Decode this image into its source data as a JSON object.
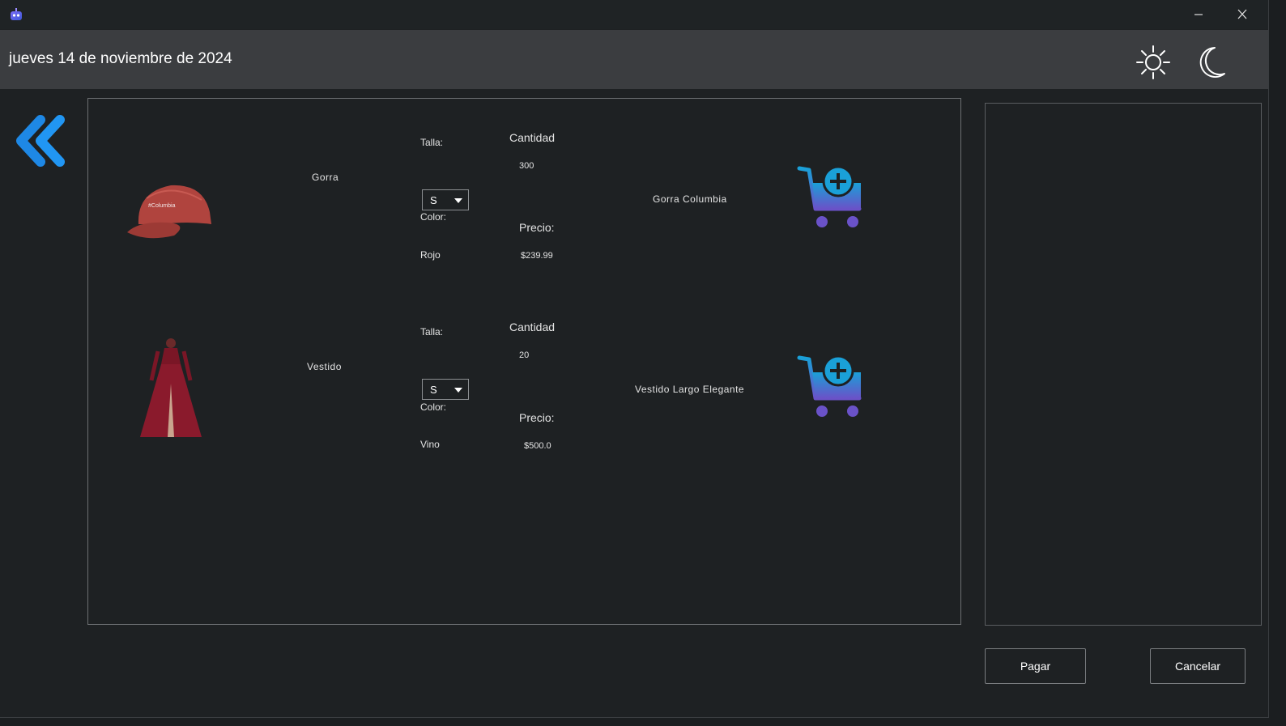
{
  "header": {
    "date": "jueves 14 de noviembre de 2024"
  },
  "icons": {
    "app": "app-icon",
    "minimize": "minimize-icon",
    "close": "close-icon",
    "light_theme": "sun-icon",
    "dark_theme": "moon-icon",
    "back": "double-chevron-left-icon",
    "add_to_cart": "cart-plus-icon"
  },
  "colors": {
    "accent": "#1e88e5",
    "background": "#1e2123",
    "header": "#3b3d40"
  },
  "products": [
    {
      "name": "Gorra",
      "image": "red-cap",
      "size_label": "Talla:",
      "size_value": "S",
      "color_label": "Color:",
      "color_value": "Rojo",
      "quantity_label": "Cantidad",
      "quantity_value": "300",
      "price_label": "Precio:",
      "price_value": "$239.99",
      "description": "Gorra Columbia"
    },
    {
      "name": "Vestido",
      "image": "wine-dress",
      "size_label": "Talla:",
      "size_value": "S",
      "color_label": "Color:",
      "color_value": "Vino",
      "quantity_label": "Cantidad",
      "quantity_value": "20",
      "price_label": "Precio:",
      "price_value": "$500.0",
      "description": "Vestido Largo Elegante"
    }
  ],
  "actions": {
    "pay": "Pagar",
    "cancel": "Cancelar"
  }
}
